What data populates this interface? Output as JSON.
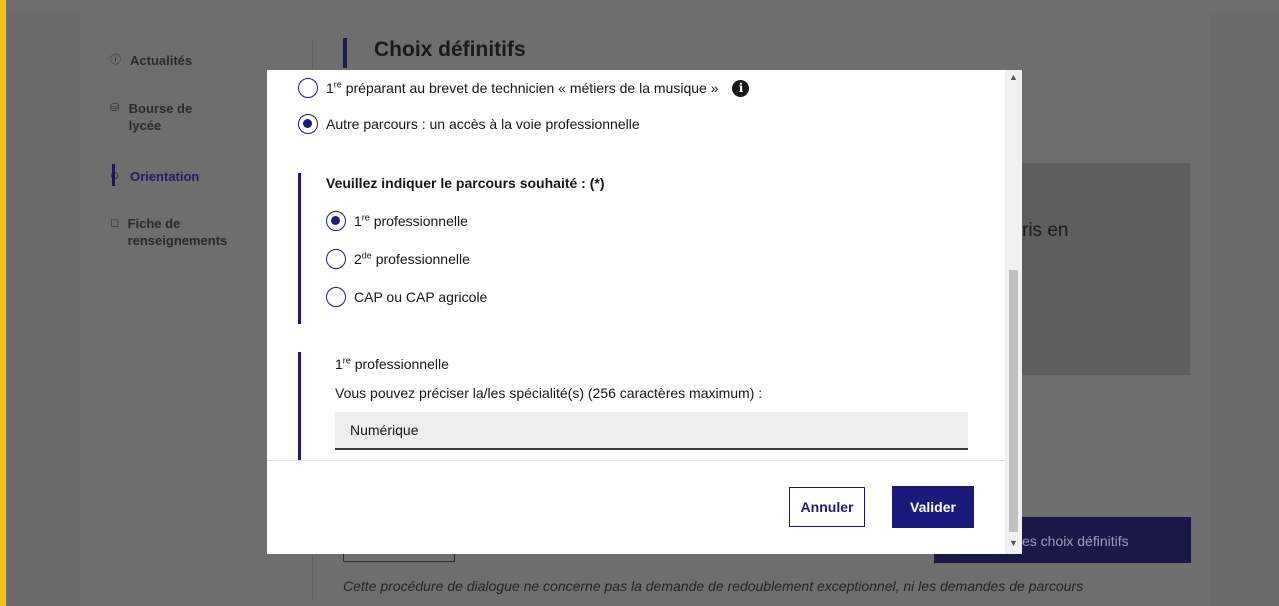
{
  "sidebar": {
    "items": [
      {
        "label": "Actualités"
      },
      {
        "label": "Bourse de lycée"
      },
      {
        "label": "Orientation"
      },
      {
        "label": "Fiche de renseignements"
      }
    ]
  },
  "page": {
    "title": "Choix définitifs",
    "partial_text": "ris en",
    "submit_button_partial": "es choix définitifs",
    "footnote": "Cette procédure de dialogue ne concerne pas la demande de redoublement exceptionnel, ni les demandes de parcours"
  },
  "modal": {
    "option_music": {
      "sup": "re",
      "label": "préparant au brevet de technicien « métiers de la musique »",
      "number": "1"
    },
    "option_other": {
      "label": "Autre parcours : un accès à la voie professionnelle"
    },
    "legend": "Veuillez indiquer le parcours souhaité : (*)",
    "choices": [
      {
        "num": "1",
        "sup": "re",
        "label": "professionnelle",
        "checked": true
      },
      {
        "num": "2",
        "sup": "de",
        "label": "professionnelle",
        "checked": false
      },
      {
        "num": "",
        "sup": "",
        "label": "CAP ou CAP agricole",
        "checked": false
      }
    ],
    "specialty": {
      "num": "1",
      "sup": "re",
      "label": "professionnelle",
      "hint": "Vous pouvez préciser la/les spécialité(s) (256 caractères maximum) :",
      "value": "Numérique"
    },
    "cancel_label": "Annuler",
    "validate_label": "Valider"
  }
}
